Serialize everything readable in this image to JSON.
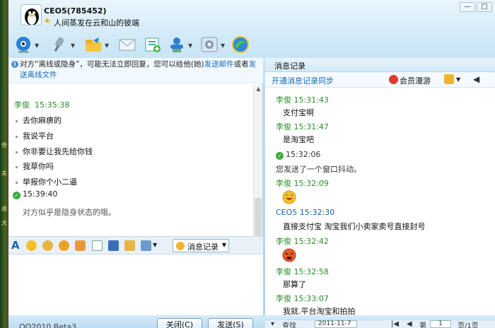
{
  "header": {
    "user_name": "CEO5(785452)",
    "signature": "人间蒸发在云和山的彼端"
  },
  "notice": {
    "text": "对方“离线或隐身”，可能无法立即回复，您可以给他(她)",
    "link1": "发送邮件",
    "text2": "或者",
    "link2": "发送离线文件"
  },
  "chat": {
    "sender": "李俊",
    "time1": "15:35:38",
    "lines": [
      "去你麻痹的",
      "我说平台",
      "你非要让我先给你钱",
      "我草你吗",
      "举报你个小二逼"
    ],
    "time2": "15:39:40",
    "system_msg": "对方似乎是隐身状态的哦。"
  },
  "format_bar": {
    "msg_record_label": "消息记录"
  },
  "bottom": {
    "version": "QQ2010 Beta3",
    "close_label": "关闭(C)",
    "send_label": "发送(S)"
  },
  "history": {
    "title": "消息记录",
    "sync_link": "开通消息记录同步",
    "roam_label": "会员漫游",
    "entries": [
      {
        "name": "李俊",
        "time": "15:31:43",
        "text": "支付宝啊"
      },
      {
        "name": "李俊",
        "time": "15:31:47",
        "text": "是淘宝吧"
      },
      {
        "time": "15:32:06",
        "text": "您发送了一个窗口抖动。"
      },
      {
        "name": "李俊",
        "time": "15:32:09"
      },
      {
        "name": "CEO5",
        "time": "15:32:30",
        "text": "直接支付宝 淘宝我们小卖家卖号直接封号"
      },
      {
        "name": "李俊",
        "time": "15:32:42"
      },
      {
        "name": "李俊",
        "time": "15:32:58",
        "text": "那算了"
      },
      {
        "name": "李俊",
        "time": "15:33:07",
        "text": "我就.平台淘宝和拍拍"
      }
    ],
    "page_label": "第",
    "page_value": "1",
    "page_total": "页/1页",
    "search_label": "查找",
    "date_value": "2011-11-7"
  },
  "icons": [
    "qq-penguin-icon",
    "video-call-icon",
    "voice-call-icon",
    "send-file-icon",
    "mail-icon",
    "app-icon",
    "share-screen-icon",
    "settings-icon",
    "browser-icon",
    "smiley-icon",
    "clock-icon",
    "shake-icon",
    "font-icon",
    "doodle-icon"
  ]
}
